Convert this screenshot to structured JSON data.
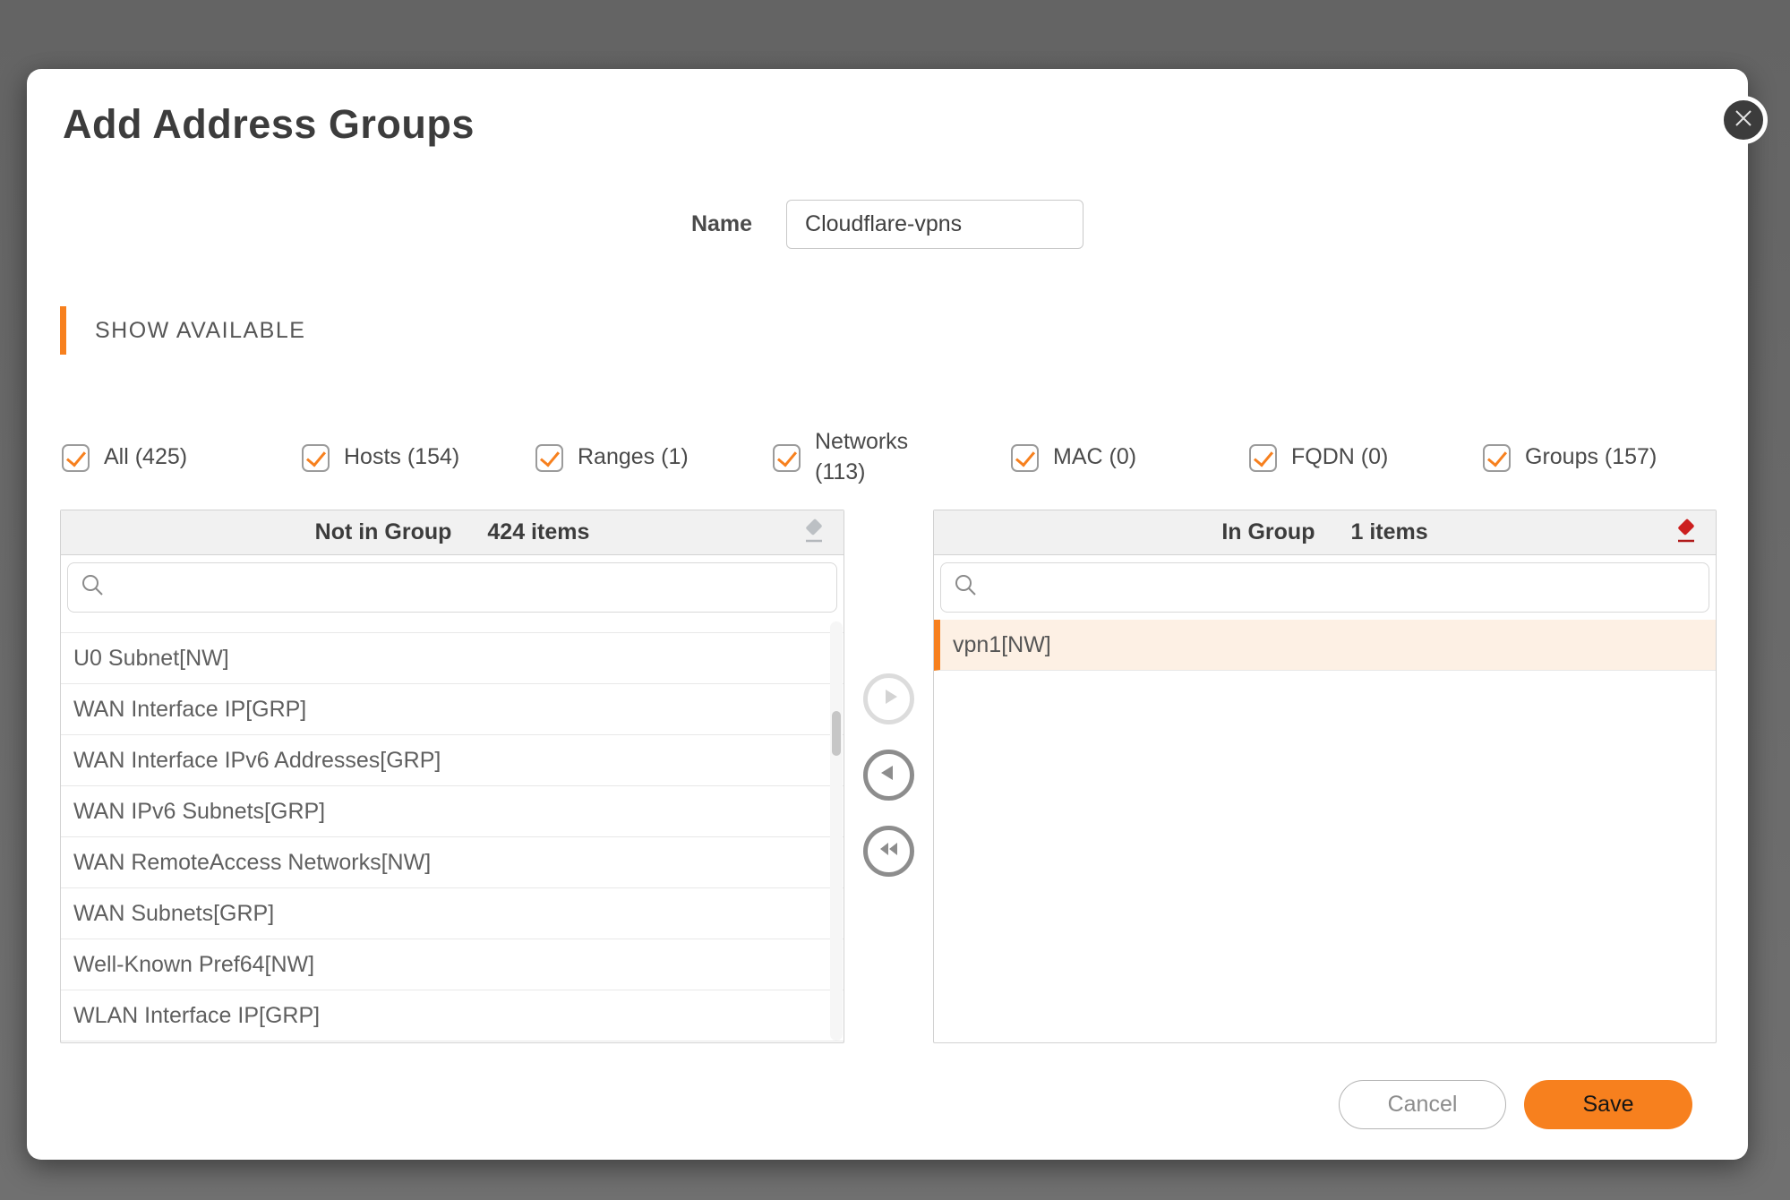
{
  "dialog": {
    "title": "Add Address Groups",
    "name_label": "Name",
    "name_value": "Cloudflare-vpns",
    "section_header": "SHOW AVAILABLE"
  },
  "filters": [
    {
      "label": "All (425)",
      "checked": true
    },
    {
      "label": "Hosts (154)",
      "checked": true
    },
    {
      "label": "Ranges (1)",
      "checked": true
    },
    {
      "label": "Networks (113)",
      "checked": true
    },
    {
      "label": "MAC (0)",
      "checked": true
    },
    {
      "label": "FQDN (0)",
      "checked": true
    },
    {
      "label": "Groups (157)",
      "checked": true
    }
  ],
  "left_panel": {
    "title": "Not in Group",
    "count": "424 items",
    "search_value": "",
    "items": [
      "U0 Subnet[NW]",
      "WAN Interface IP[GRP]",
      "WAN Interface IPv6 Addresses[GRP]",
      "WAN IPv6 Subnets[GRP]",
      "WAN RemoteAccess Networks[NW]",
      "WAN Subnets[GRP]",
      "Well-Known Pref64[NW]",
      "WLAN Interface IP[GRP]"
    ]
  },
  "right_panel": {
    "title": "In Group",
    "count": "1 items",
    "search_value": "",
    "items": [
      "vpn1[NW]"
    ],
    "selected_index": 0
  },
  "footer": {
    "cancel_label": "Cancel",
    "save_label": "Save"
  },
  "icons": {
    "close": "x-cross",
    "search": "magnifier",
    "clear_left": "eraser-gray",
    "clear_right": "eraser-red",
    "move_right": "arrow-right-circle (disabled)",
    "move_left": "arrow-left-circle",
    "move_all_left": "double-arrow-left-circle"
  },
  "colors": {
    "accent_orange": "#f7801e",
    "selected_row_bg": "#fdf0e4",
    "eraser_red": "#cc1f1f",
    "eraser_gray": "#bcc0c4",
    "overlay_gray": "#6a6a6a"
  }
}
